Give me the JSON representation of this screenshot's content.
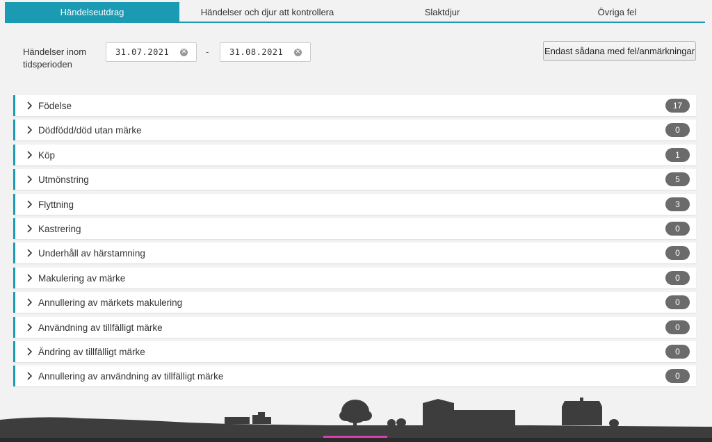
{
  "tabs": [
    {
      "label": "Händelseutdrag",
      "active": true
    },
    {
      "label": "Händelser och djur att kontrollera",
      "active": false
    },
    {
      "label": "Slaktdjur",
      "active": false
    },
    {
      "label": "Övriga fel",
      "active": false
    }
  ],
  "filter": {
    "period_label": "Händelser inom tidsperioden",
    "date_from": "31.07.2021",
    "separator": "-",
    "date_to": "31.08.2021",
    "only_errors_button": "Endast sådana med fel/anmärkningar"
  },
  "events": [
    {
      "label": "Födelse",
      "count": "17"
    },
    {
      "label": "Dödfödd/död utan märke",
      "count": "0"
    },
    {
      "label": "Köp",
      "count": "1"
    },
    {
      "label": "Utmönstring",
      "count": "5"
    },
    {
      "label": "Flyttning",
      "count": "3"
    },
    {
      "label": "Kastrering",
      "count": "0"
    },
    {
      "label": "Underhåll av härstamning",
      "count": "0"
    },
    {
      "label": "Makulering av märke",
      "count": "0"
    },
    {
      "label": "Annullering av märkets makulering",
      "count": "0"
    },
    {
      "label": "Användning av tillfälligt märke",
      "count": "0"
    },
    {
      "label": "Ändring av tillfälligt märke",
      "count": "0"
    },
    {
      "label": "Annullering av användning av tillfälligt märke",
      "count": "0"
    }
  ],
  "colors": {
    "accent": "#1a9bb3",
    "badge": "#6b6b6b",
    "silhouette": "#3d3d3d",
    "highlight": "#d63fae"
  },
  "icons": {
    "expand": "chevron-right-icon",
    "clear": "clear-circle-icon"
  }
}
